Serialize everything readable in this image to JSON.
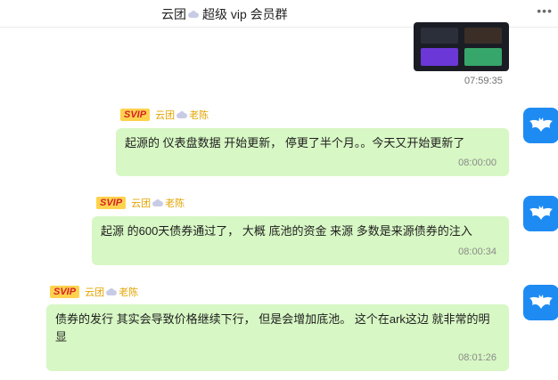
{
  "header": {
    "group_prefix": "云团",
    "group_suffix": "超级 vip 会员群",
    "more_label": "•••"
  },
  "image_message": {
    "time": "07:59:35"
  },
  "messages": [
    {
      "badge": "SVIP",
      "sender_prefix": "云团",
      "sender_suffix": "老陈",
      "text": "起源的  仪表盘数据  开始更新，  停更了半个月。。今天又开始更新了",
      "time": "08:00:00"
    },
    {
      "badge": "SVIP",
      "sender_prefix": "云团",
      "sender_suffix": "老陈",
      "text": "起源 的600天债券通过了，  大概 底池的资金 来源  多数是来源债券的注入",
      "time": "08:00:34"
    },
    {
      "badge": "SVIP",
      "sender_prefix": "云团",
      "sender_suffix": "老陈",
      "text": "债券的发行 其实会导致价格继续下行，  但是会增加底池。 这个在ark这边 就非常的明显",
      "time": "08:01:26"
    }
  ],
  "colors": {
    "bubble": "#d7f7c4",
    "avatar": "#1e8bf2",
    "badge_bg": "#ffd24d",
    "badge_text": "#d4202a",
    "sender": "#e2a400"
  },
  "icons": [
    "cloud-icon",
    "bat-avatar-icon",
    "more-dots-icon"
  ]
}
